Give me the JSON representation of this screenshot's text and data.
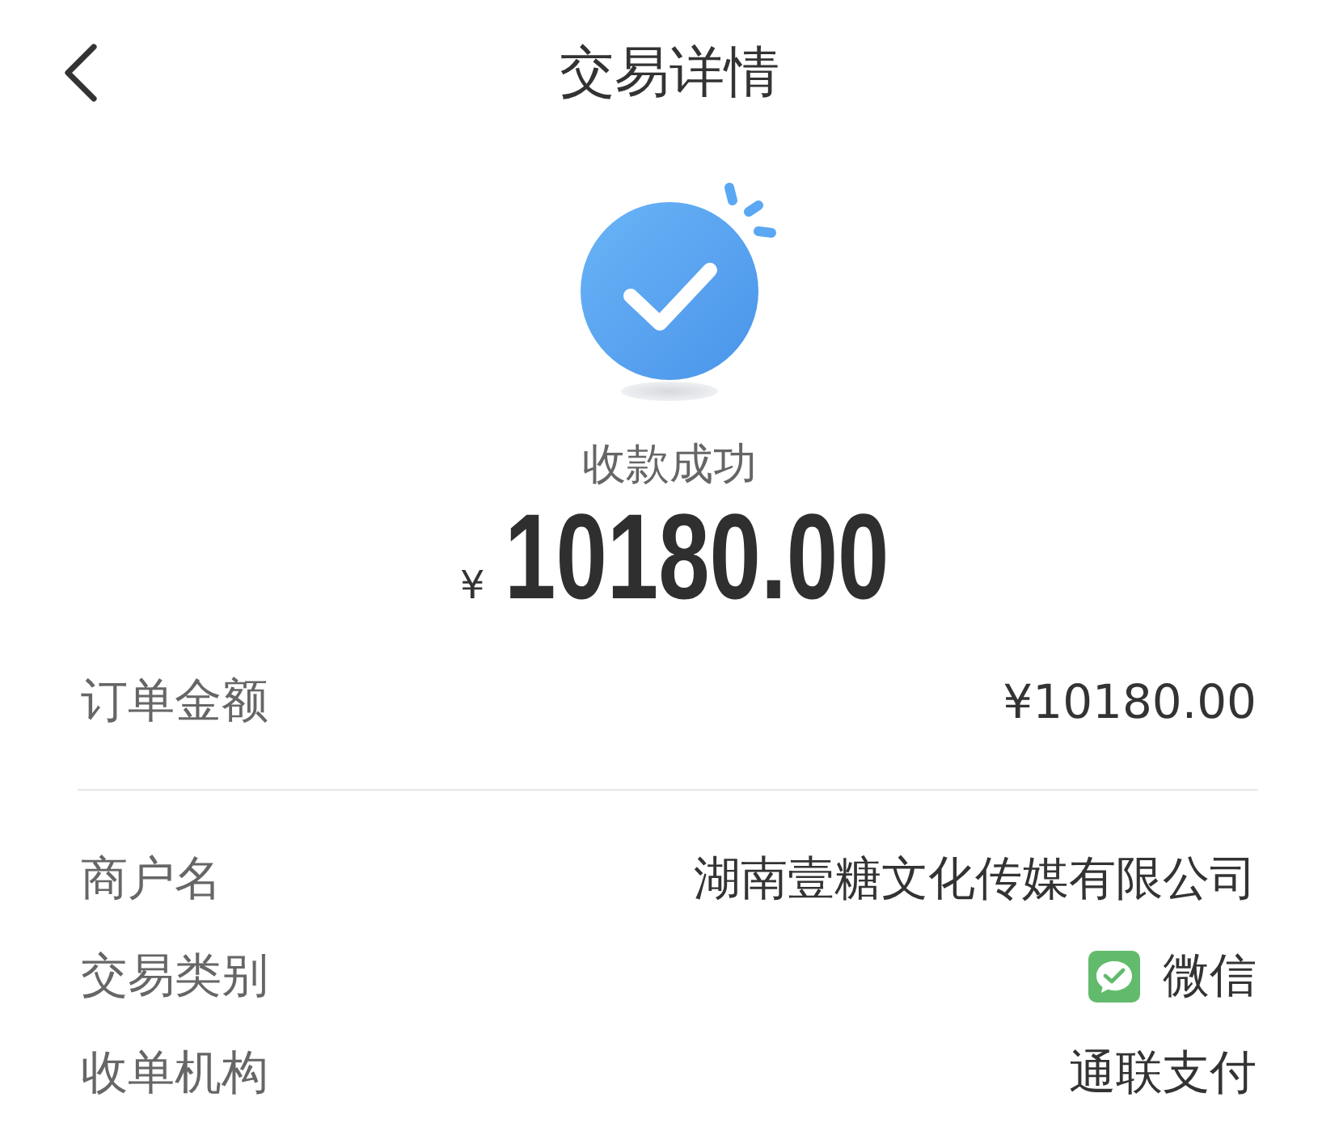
{
  "header": {
    "title": "交易详情"
  },
  "status": {
    "label": "收款成功"
  },
  "amount": {
    "currency": "¥",
    "value": "10180.00"
  },
  "summary_rows": [
    {
      "label": "订单金额",
      "value": "¥10180.00"
    }
  ],
  "detail_rows": [
    {
      "kind": "text",
      "label": "商户名",
      "value": "湖南壹糖文化传媒有限公司"
    },
    {
      "kind": "wechat",
      "label": "交易类别",
      "value": "微信"
    },
    {
      "kind": "text",
      "label": "收单机构",
      "value": "通联支付"
    }
  ]
}
